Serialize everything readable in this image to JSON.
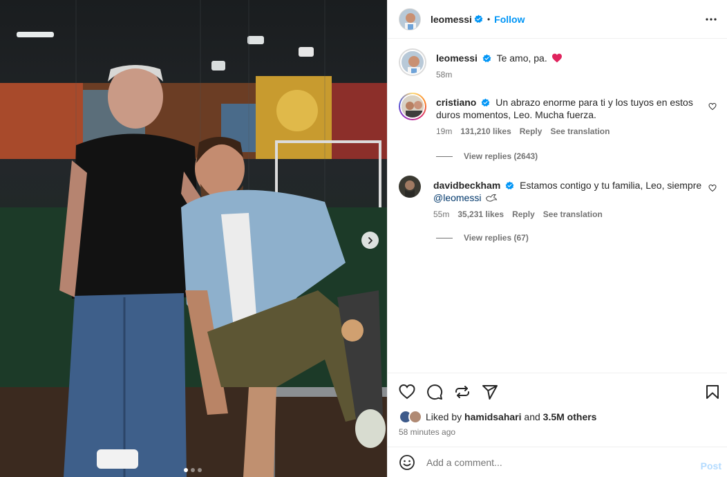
{
  "post": {
    "author": "leomessi",
    "follow_label": "Follow",
    "bullet": "•",
    "image_alt": "Two men posing together at an indoor football pitch",
    "carousel": {
      "slides": 3,
      "active": 1
    }
  },
  "caption": {
    "username": "leomessi",
    "text": "Te amo, pa.",
    "time": "58m"
  },
  "comments": [
    {
      "username": "cristiano",
      "text": "Un abrazo enorme para ti y los tuyos en estos duros momentos, Leo. Mucha fuerza.",
      "time": "19m",
      "likes": "131,210 likes",
      "reply_label": "Reply",
      "translate_label": "See translation",
      "view_replies": "View replies (2643)"
    },
    {
      "username": "davidbeckham",
      "text": "Estamos contigo y tu familia, Leo, siempre",
      "mention": "@leomessi",
      "time": "55m",
      "likes": "35,231 likes",
      "reply_label": "Reply",
      "translate_label": "See translation",
      "view_replies": "View replies (67)"
    }
  ],
  "likes": {
    "prefix": "Liked by",
    "user": "hamidsahari",
    "and": "and",
    "others": "3.5M others"
  },
  "timestamp": "58 minutes ago",
  "add_comment": {
    "placeholder": "Add a comment...",
    "post_label": "Post"
  },
  "colors": {
    "link": "#0095f6",
    "verified": "#0095f6",
    "heart": "#ed4956",
    "muted": "#737373"
  }
}
